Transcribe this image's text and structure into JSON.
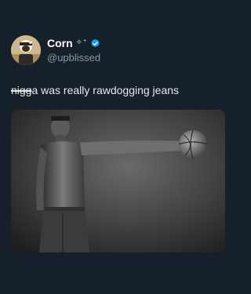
{
  "tweet": {
    "display_name": "Corn",
    "display_name_emoji": "✧⁺",
    "handle": "@upblissed",
    "text_struck": "nigg",
    "text_rest": "a was really rawdogging jeans",
    "avatar_icon": "avatar-image",
    "verified_icon": "verified-badge-icon",
    "verified_color": "#1d9bf0",
    "background_color": "#15202b",
    "media_description_icon": "photo-image"
  }
}
